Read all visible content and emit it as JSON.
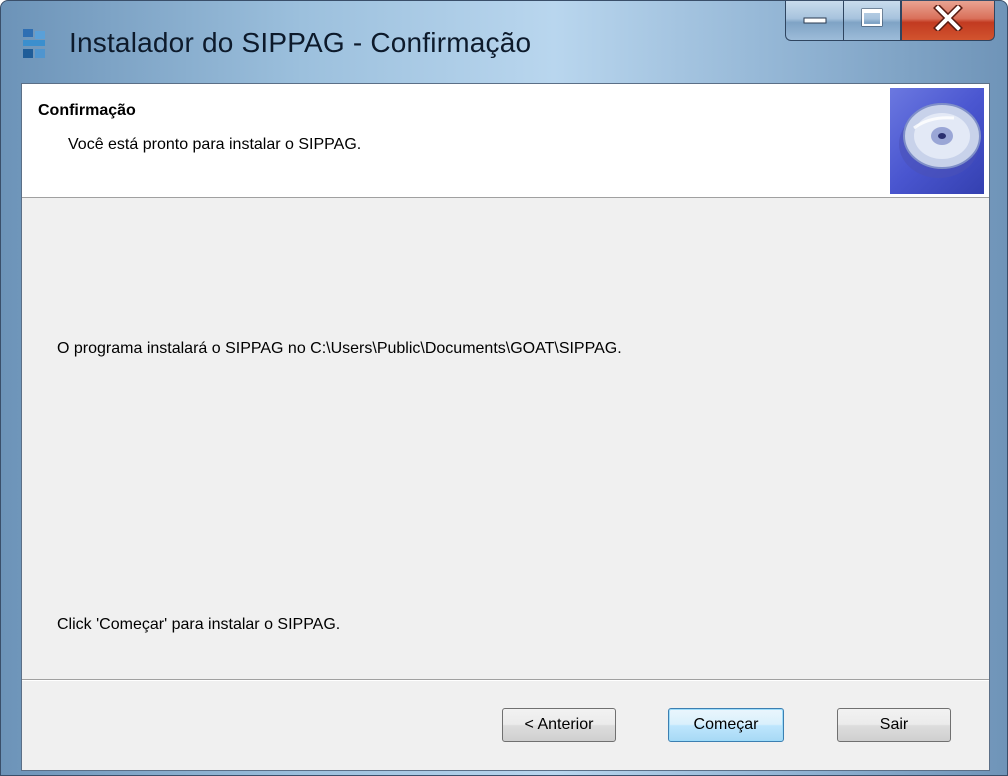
{
  "window": {
    "title": "Instalador do SIPPAG - Confirmação",
    "icons": [
      "app-icon",
      "minimize-icon",
      "maximize-icon",
      "close-icon"
    ]
  },
  "header": {
    "title": "Confirmação",
    "subtitle": "Você está pronto para instalar o SIPPAG.",
    "image_icon": "cd-disc-icon"
  },
  "body": {
    "install_path_text": "O programa instalará o SIPPAG no C:\\Users\\Public\\Documents\\GOAT\\SIPPAG.",
    "click_text": "Click 'Começar' para instalar o SIPPAG."
  },
  "buttons": {
    "back_label": "< Anterior",
    "start_label": "Começar",
    "exit_label": "Sair"
  },
  "colors": {
    "header_bg": "#ffffff",
    "dialog_bg": "#f0f0f0",
    "close_button": "#c23a20",
    "default_button_border": "#3c7fb1"
  }
}
